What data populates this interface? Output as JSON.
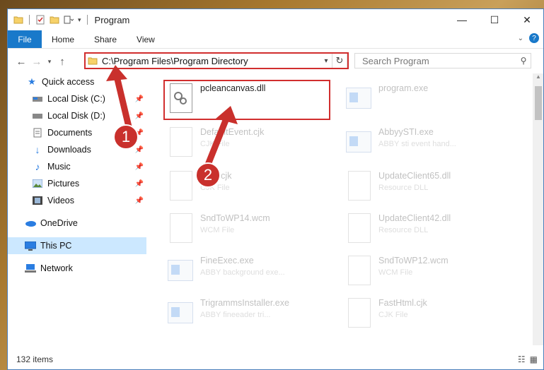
{
  "window": {
    "title": "Program"
  },
  "ribbon": {
    "file": "File",
    "tabs": [
      "Home",
      "Share",
      "View"
    ]
  },
  "address": {
    "path": "C:\\Program Files\\Program Directory"
  },
  "search": {
    "placeholder": "Search Program"
  },
  "sidebar": {
    "items": [
      {
        "label": "Quick access",
        "icon": "star-icon"
      },
      {
        "label": "Local Disk (C:)",
        "icon": "drive-icon",
        "pinned": true
      },
      {
        "label": "Local Disk (D:)",
        "icon": "drive-icon",
        "pinned": true
      },
      {
        "label": "Documents",
        "icon": "documents-icon",
        "pinned": true
      },
      {
        "label": "Downloads",
        "icon": "downloads-icon",
        "pinned": true
      },
      {
        "label": "Music",
        "icon": "music-icon",
        "pinned": true
      },
      {
        "label": "Pictures",
        "icon": "pictures-icon",
        "pinned": true
      },
      {
        "label": "Videos",
        "icon": "videos-icon",
        "pinned": true
      },
      {
        "label": "OneDrive",
        "icon": "onedrive-icon"
      },
      {
        "label": "This PC",
        "icon": "pc-icon"
      },
      {
        "label": "Network",
        "icon": "network-icon"
      }
    ]
  },
  "files": [
    {
      "name": "pcleancanvas.dll",
      "sub": ""
    },
    {
      "name": "program.exe",
      "sub": ""
    },
    {
      "name": "DefaultEvent.cjk",
      "sub": "CJK File"
    },
    {
      "name": "AbbyySTI.exe",
      "sub": "ABBY sti event hand..."
    },
    {
      "name": "Html.cjk",
      "sub": "CJK File"
    },
    {
      "name": "UpdateClient65.dll",
      "sub": "Resource DLL"
    },
    {
      "name": "SndToWP14.wcm",
      "sub": "WCM File"
    },
    {
      "name": "UpdateClient42.dll",
      "sub": "Resource DLL"
    },
    {
      "name": "FineExec.exe",
      "sub": "ABBY background exe..."
    },
    {
      "name": "SndToWP12.wcm",
      "sub": "WCM File"
    },
    {
      "name": "TrigrammsInstaller.exe",
      "sub": "ABBY fineeader tri..."
    },
    {
      "name": "FastHtml.cjk",
      "sub": "CJK File"
    }
  ],
  "status": {
    "count": "132 items"
  },
  "callouts": {
    "one": "1",
    "two": "2"
  },
  "colors": {
    "accent": "#1979ca",
    "highlight": "#d12e2e",
    "selected": "#cce8ff"
  }
}
